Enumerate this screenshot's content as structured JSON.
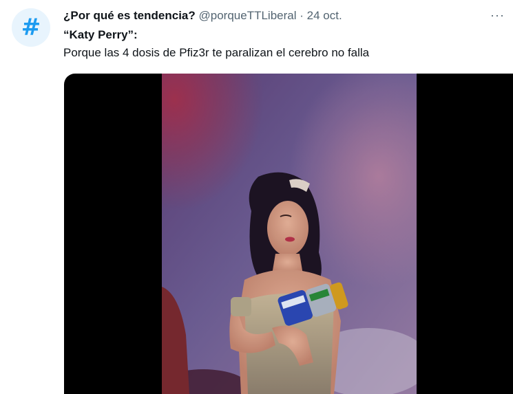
{
  "tweet": {
    "display_name": "¿Por qué es tendencia?",
    "handle": "@porqueTTLiberal",
    "separator": "·",
    "date": "24 oct.",
    "more_glyph": "···",
    "topic_line": "“Katy Perry”:",
    "body_line": "Porque las 4 dosis de Pfiz3r te paralizan el cerebro no falla"
  },
  "avatar": {
    "glyph": "#",
    "icon": "hashtag-icon",
    "color": "#1d9bf0"
  },
  "media": {
    "type": "video-frame",
    "background": "#000000"
  }
}
